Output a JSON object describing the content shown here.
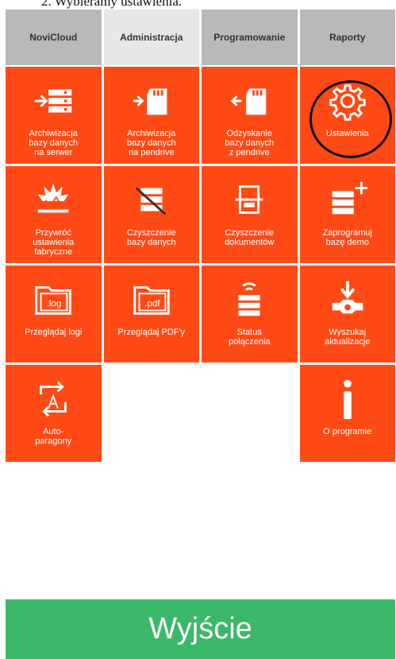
{
  "doc_caption": "2.     Wybieramy ustawienia.",
  "tabs": [
    "NoviCloud",
    "Administracja",
    "Programowanie",
    "Raporty"
  ],
  "tiles": [
    {
      "label": "Archiwizacja\nbazy danych\nna serwer",
      "icon": "archive-to-server-icon"
    },
    {
      "label": "Archiwizacja\nbazy danych\nna pendrive",
      "icon": "archive-to-sd-card-icon"
    },
    {
      "label": "Odzyskanie\nbazy danych\nz pendrive",
      "icon": "restore-from-sd-card-icon"
    },
    {
      "label": "Ustawienia",
      "icon": "gear-icon"
    },
    {
      "label": "Przywróć\nustawienia\nfabryczne",
      "icon": "factory-reset-explosion-icon"
    },
    {
      "label": "Czyszczenie\nbazy danych",
      "icon": "clear-database-icon"
    },
    {
      "label": "Czyszczenie\ndokumentów",
      "icon": "clear-documents-icon"
    },
    {
      "label": "Zaprogramuj\nbazę demo",
      "icon": "demo-database-icon"
    },
    {
      "label": "Przeglądaj logi",
      "icon": "log-folder-icon"
    },
    {
      "label": "Przeglądaj PDF'y",
      "icon": "pdf-folder-icon"
    },
    {
      "label": "Status\npołączenia",
      "icon": "connection-status-icon"
    },
    {
      "label": "Wyszukaj\naktualizacje",
      "icon": "download-update-icon"
    },
    {
      "label": "Auto-\nparagony",
      "icon": "auto-receipt-icon"
    },
    {
      "label": "O programie",
      "icon": "info-icon"
    }
  ],
  "exit_label": "Wyjście",
  "colors": {
    "tile": "#ff4a15",
    "tab": "#b9b9b9",
    "tab_active": "#e7e7e5",
    "exit": "#3cb86a"
  }
}
